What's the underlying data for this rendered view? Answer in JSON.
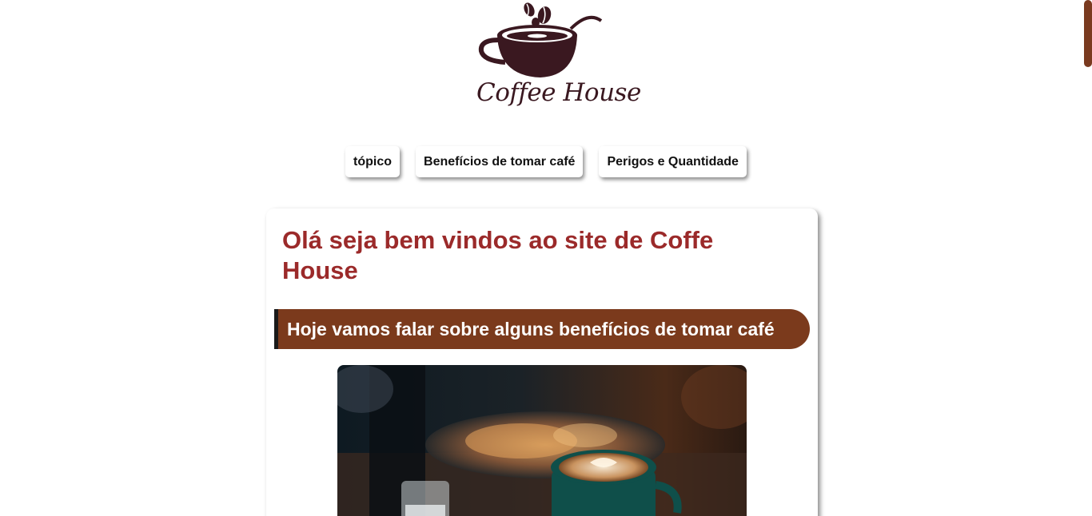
{
  "brand": {
    "logo_text": "Coffee House"
  },
  "nav": {
    "items": [
      {
        "label": "tópico"
      },
      {
        "label": "Benefícios de tomar café"
      },
      {
        "label": "Perigos e Quantidade"
      }
    ]
  },
  "main": {
    "title": "Olá seja bem vindos ao site de Coffe House",
    "banner": "Hoje vamos falar sobre alguns benefícios de tomar café",
    "image_subject": "latte-art-coffee-cup-photo"
  },
  "colors": {
    "accent_brown": "#7b3a1c",
    "title_red": "#9b2a2a",
    "logo_dark": "#3a1820",
    "scroll_thumb": "#7a3a1f"
  }
}
